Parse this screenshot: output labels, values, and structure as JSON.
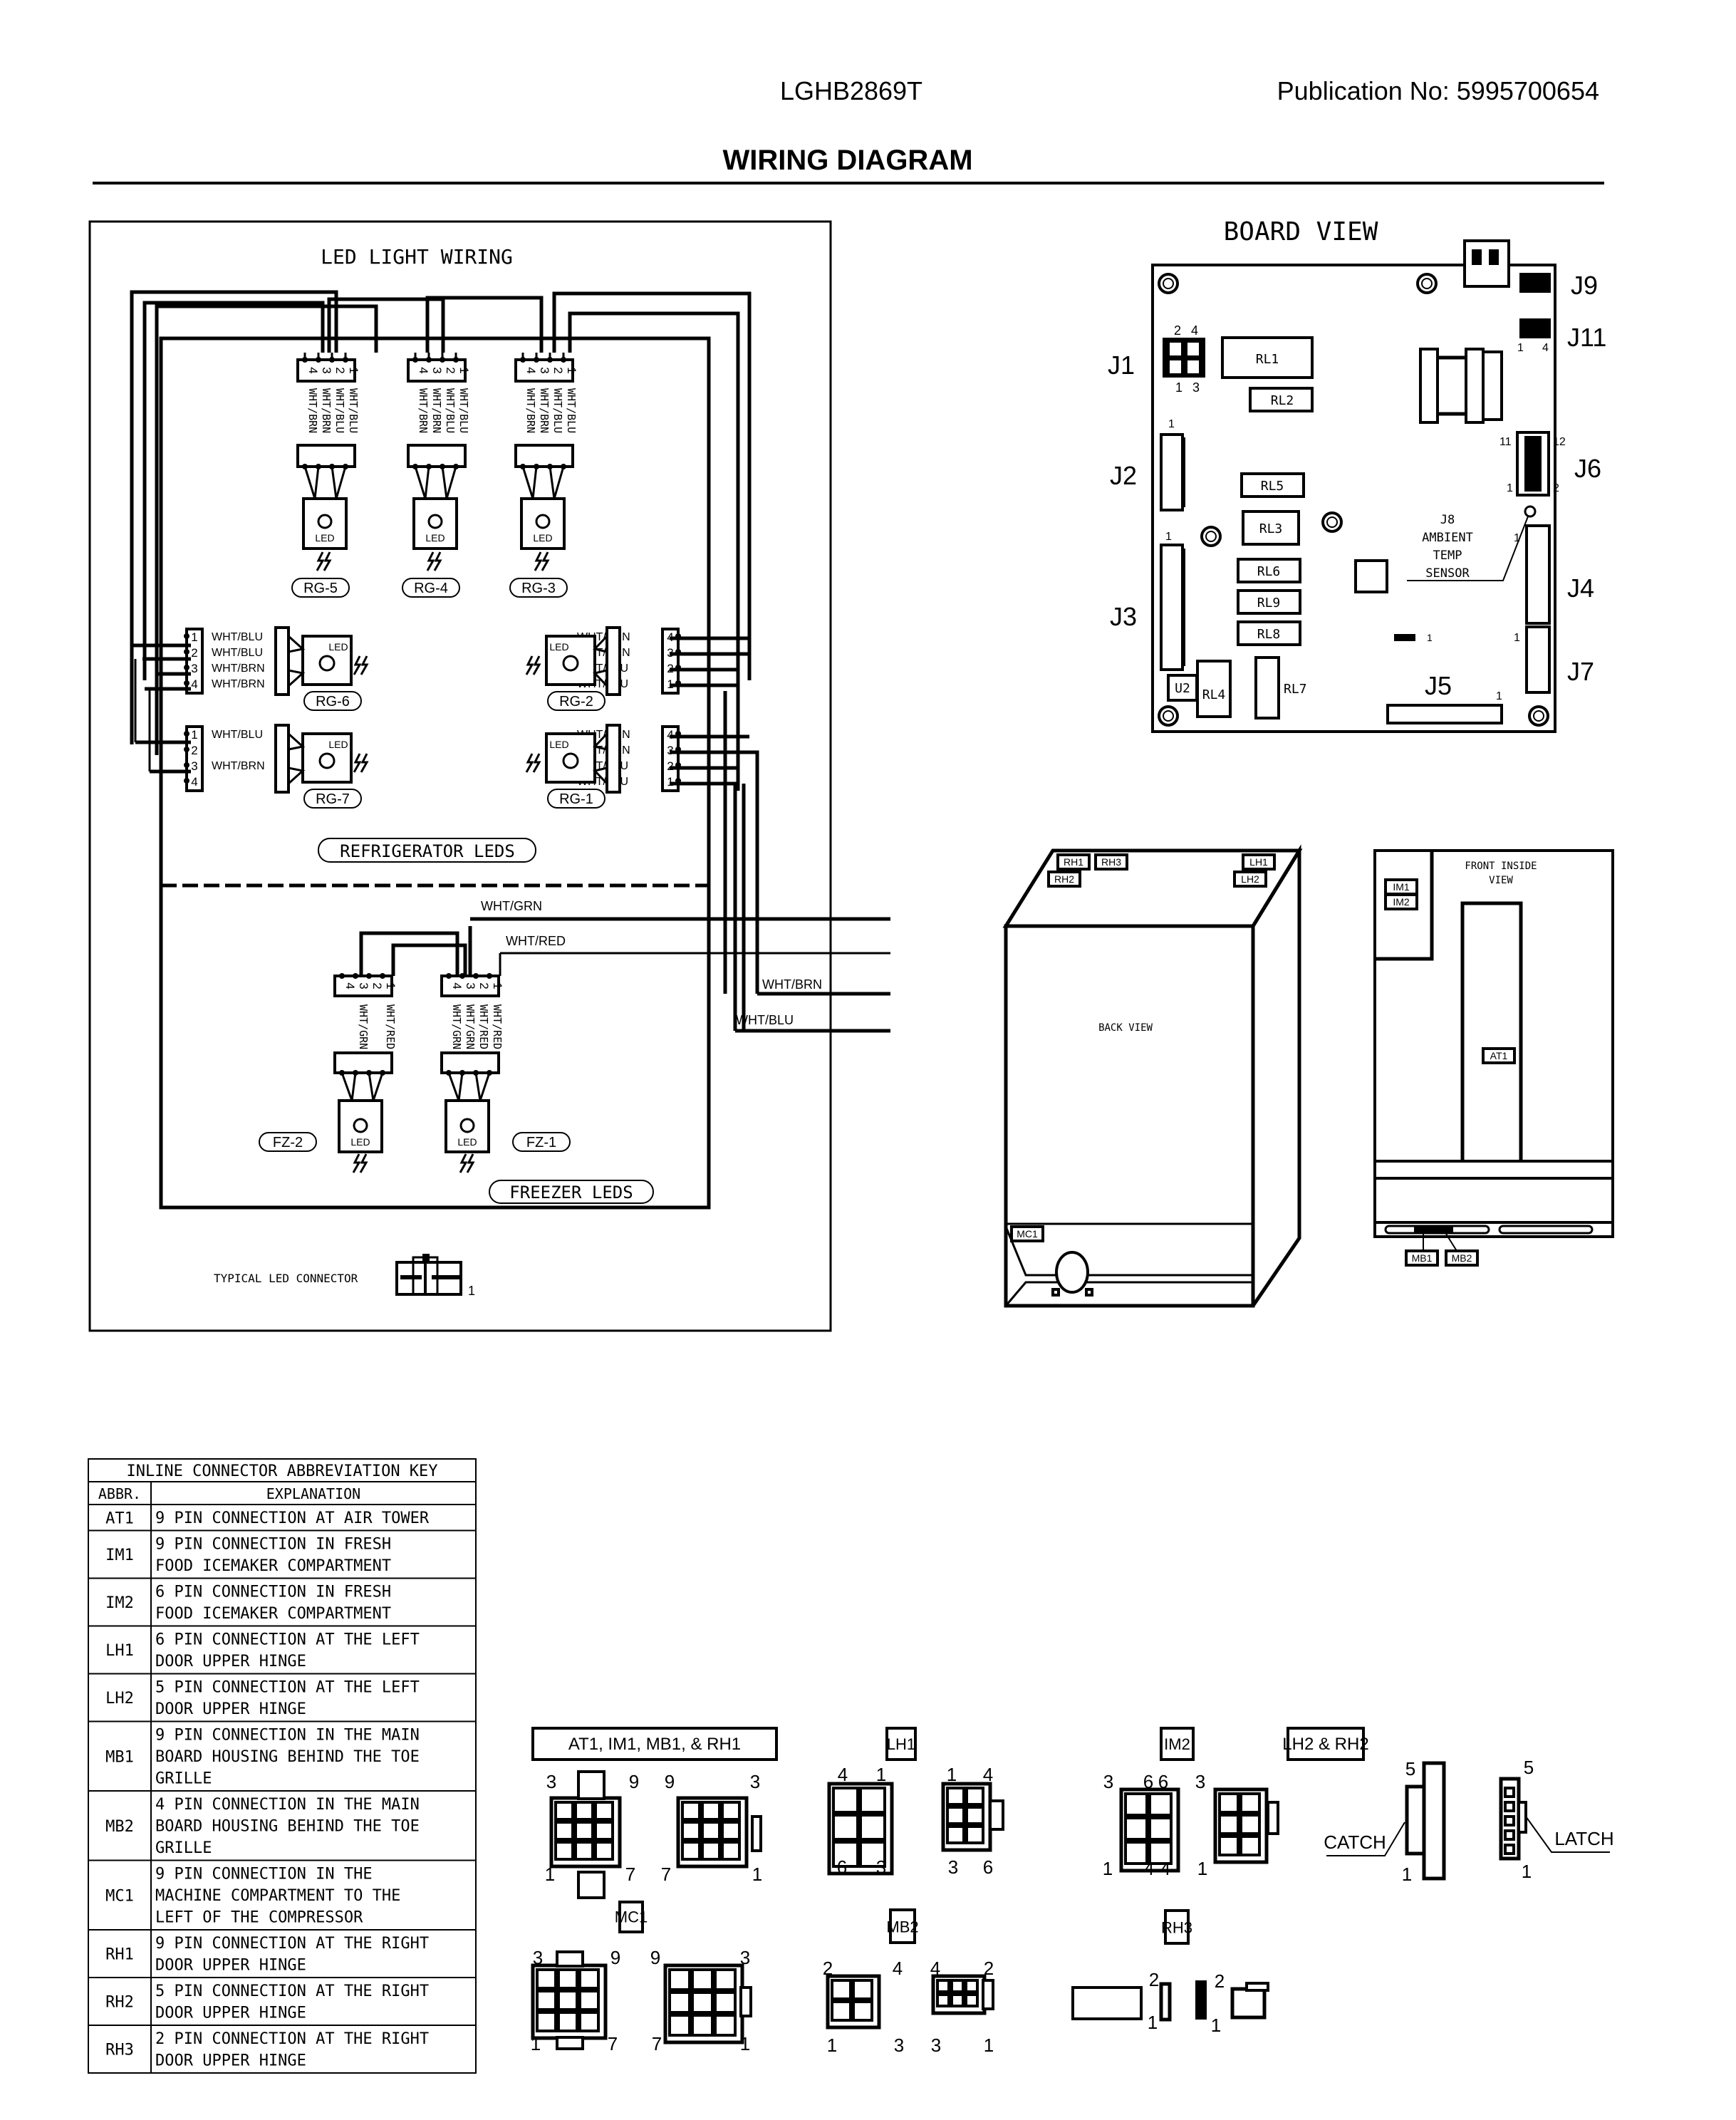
{
  "header": {
    "model": "LGHB2869T",
    "publication": "Publication No:  5995700654",
    "title": "WIRING DIAGRAM"
  },
  "led_wiring": {
    "title": "LED LIGHT WIRING",
    "top_connectors": [
      {
        "id": "RG-5",
        "pins": [
          "4",
          "3",
          "2",
          "1"
        ],
        "wires": [
          "WHT/BRN",
          "WHT/BRN",
          "WHT/BLU",
          "WHT/BLU"
        ]
      },
      {
        "id": "RG-4",
        "pins": [
          "4",
          "3",
          "2",
          "1"
        ],
        "wires": [
          "WHT/BRN",
          "WHT/BRN",
          "WHT/BLU",
          "WHT/BLU"
        ]
      },
      {
        "id": "RG-3",
        "pins": [
          "4",
          "3",
          "2",
          "1"
        ],
        "wires": [
          "WHT/BRN",
          "WHT/BRN",
          "WHT/BLU",
          "WHT/BLU"
        ]
      }
    ],
    "led_label": "LED",
    "left_connectors": [
      {
        "id": "RG-6",
        "pins": [
          "1",
          "2",
          "3",
          "4"
        ],
        "wires": [
          "WHT/BLU",
          "WHT/BLU",
          "WHT/BRN",
          "WHT/BRN"
        ]
      },
      {
        "id": "RG-7",
        "pins": [
          "1",
          "2",
          "3",
          "4"
        ],
        "wires": [
          "WHT/BLU",
          "",
          "WHT/BRN",
          ""
        ]
      }
    ],
    "right_connectors": [
      {
        "id": "RG-2",
        "pins": [
          "4",
          "3",
          "2",
          "1"
        ],
        "wires": [
          "WHT/BRN",
          "WHT/BRN",
          "WHT/BLU",
          "WHT/BLU"
        ]
      },
      {
        "id": "RG-1",
        "pins": [
          "4",
          "3",
          "2",
          "1"
        ],
        "wires": [
          "WHT/BRN",
          "WHT/BRN",
          "WHT/BLU",
          "WHT/BLU"
        ]
      }
    ],
    "refrigerator_label": "REFRIGERATOR LEDS",
    "freezer": {
      "label": "FREEZER LEDS",
      "connectors": [
        {
          "id": "FZ-2",
          "pins": [
            "4",
            "3",
            "2",
            "1"
          ],
          "wires": [
            "WHT/GRN",
            "WHT/RED"
          ]
        },
        {
          "id": "FZ-1",
          "pins": [
            "4",
            "3",
            "2",
            "1"
          ],
          "wires": [
            "WHT/GRN",
            "WHT/GRN",
            "WHT/RED",
            "WHT/RED"
          ]
        }
      ]
    },
    "exit_wires": [
      "WHT/GRN",
      "WHT/RED",
      "WHT/BRN",
      "WHT/BLU"
    ],
    "typical_connector_label": "TYPICAL LED CONNECTOR",
    "typical_connector_pin": "1"
  },
  "board_view": {
    "title": "BOARD VIEW",
    "connectors": [
      "J1",
      "J2",
      "J3",
      "J4",
      "J5",
      "J6",
      "J7",
      "J9",
      "J11"
    ],
    "relays": [
      "RL1",
      "RL2",
      "RL3",
      "RL4",
      "RL5",
      "RL6",
      "RL7",
      "RL8",
      "RL9"
    ],
    "u2": "U2",
    "j1_pins": [
      "2",
      "4",
      "1",
      "3"
    ],
    "j11_pins": [
      "1",
      "4"
    ],
    "j6_pins": [
      "11",
      "12",
      "1",
      "2"
    ],
    "pin_one": "1",
    "sensor_label": [
      "J8",
      "AMBIENT",
      "TEMP",
      "SENSOR"
    ]
  },
  "back_view": {
    "label": "BACK VIEW",
    "tags": [
      "RH1",
      "RH3",
      "RH2",
      "LH1",
      "LH2",
      "MC1"
    ]
  },
  "front_view": {
    "label": [
      "FRONT INSIDE",
      "VIEW"
    ],
    "tags": [
      "IM1",
      "IM2",
      "AT1",
      "MB1",
      "MB2"
    ]
  },
  "abbreviation_key": {
    "title": "INLINE CONNECTOR ABBREVIATION KEY",
    "headers": [
      "ABBR.",
      "EXPLANATION"
    ],
    "rows": [
      {
        "abbr": "AT1",
        "lines": [
          "9 PIN CONNECTION AT AIR TOWER"
        ]
      },
      {
        "abbr": "IM1",
        "lines": [
          "9 PIN CONNECTION IN FRESH",
          "FOOD ICEMAKER COMPARTMENT"
        ]
      },
      {
        "abbr": "IM2",
        "lines": [
          "6 PIN CONNECTION IN FRESH",
          "FOOD ICEMAKER COMPARTMENT"
        ]
      },
      {
        "abbr": "LH1",
        "lines": [
          "6 PIN CONNECTION AT THE LEFT",
          "DOOR UPPER HINGE"
        ]
      },
      {
        "abbr": "LH2",
        "lines": [
          "5 PIN CONNECTION AT THE LEFT",
          "DOOR UPPER HINGE"
        ]
      },
      {
        "abbr": "MB1",
        "lines": [
          "9 PIN CONNECTION IN THE MAIN",
          "BOARD HOUSING BEHIND THE TOE",
          "GRILLE"
        ]
      },
      {
        "abbr": "MB2",
        "lines": [
          "4 PIN CONNECTION IN THE MAIN",
          "BOARD HOUSING BEHIND THE TOE",
          "GRILLE"
        ]
      },
      {
        "abbr": "MC1",
        "lines": [
          "9 PIN CONNECTION IN THE",
          "MACHINE COMPARTMENT TO THE",
          "LEFT OF THE COMPRESSOR"
        ]
      },
      {
        "abbr": "RH1",
        "lines": [
          "9 PIN CONNECTION AT THE RIGHT",
          "DOOR UPPER HINGE"
        ]
      },
      {
        "abbr": "RH2",
        "lines": [
          "5 PIN CONNECTION AT THE RIGHT",
          "DOOR UPPER HINGE"
        ]
      },
      {
        "abbr": "RH3",
        "lines": [
          "2 PIN CONNECTION AT THE RIGHT",
          "DOOR UPPER HINGE"
        ]
      }
    ]
  },
  "connector_details": {
    "at1_group": {
      "label": "AT1, IM1, MB1, & RH1",
      "pins_a": [
        "3",
        "9",
        "1",
        "7"
      ],
      "pins_b": [
        "9",
        "3",
        "7",
        "1"
      ]
    },
    "lh1": {
      "label": "LH1",
      "pins_a": [
        "4",
        "1",
        "6",
        "3"
      ],
      "pins_b": [
        "1",
        "4",
        "3",
        "6"
      ]
    },
    "im2": {
      "label": "IM2",
      "pins_a": [
        "3",
        "6",
        "1",
        "4"
      ],
      "pins_b": [
        "6",
        "3",
        "4",
        "1"
      ]
    },
    "lh2_rh2": {
      "label": "LH2 & RH2",
      "pins_a": [
        "5",
        "1"
      ],
      "pins_b": [
        "5",
        "1"
      ],
      "catch": "CATCH",
      "latch": "LATCH"
    },
    "mc1": {
      "label": "MC1",
      "pins_a": [
        "3",
        "9",
        "1",
        "7"
      ],
      "pins_b": [
        "9",
        "3",
        "7",
        "1"
      ]
    },
    "mb2": {
      "label": "MB2",
      "pins_a": [
        "2",
        "4",
        "1",
        "3"
      ],
      "pins_b": [
        "4",
        "2",
        "3",
        "1"
      ]
    },
    "rh3": {
      "label": "RH3",
      "pins_a": [
        "2",
        "1"
      ],
      "pins_b": [
        "2",
        "1"
      ]
    }
  }
}
